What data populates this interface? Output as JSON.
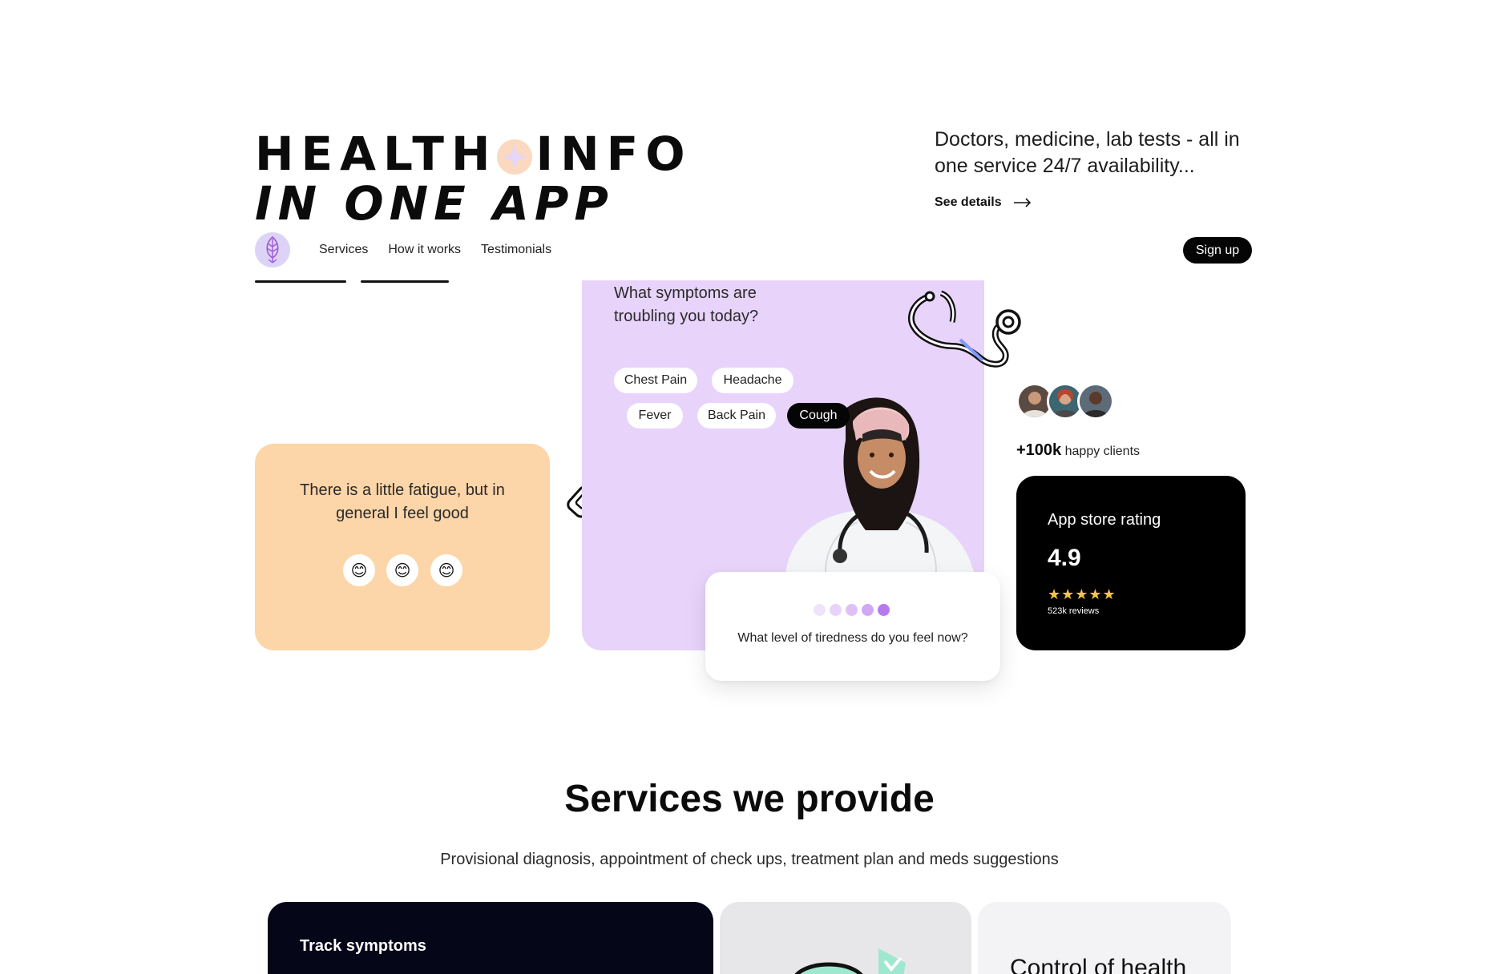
{
  "hero": {
    "line1_a": "HEALTH",
    "line1_b": "INFO",
    "line2": "IN ONE APP"
  },
  "tagline": {
    "text": "Doctors, medicine, lab tests - all in one service 24/7 availability...",
    "cta": "See details"
  },
  "nav": {
    "items": [
      "Services",
      "How it works",
      "Testimonials"
    ],
    "signup": "Sign up"
  },
  "mood_card": {
    "text": "There is a little fatigue, but in general I feel good",
    "emojis": [
      "😊",
      "😊",
      "😊"
    ]
  },
  "symptoms_card": {
    "question": "What symptoms are troubling you today?",
    "chips": [
      "Chest Pain",
      "Headache",
      "Fever",
      "Back Pain",
      "Cough"
    ],
    "selected": "Cough"
  },
  "tiredness_card": {
    "question": "What level of tiredness do you feel now?",
    "level": 5,
    "max_level": 5
  },
  "social_proof": {
    "count": "+100k",
    "label": "happy clients"
  },
  "rating_card": {
    "title": "App store rating",
    "value": "4.9",
    "stars": "★★★★★",
    "reviews": "523k reviews"
  },
  "services": {
    "title": "Services we provide",
    "subtitle": "Provisional diagnosis, appointment of check ups, treatment plan and meds suggestions",
    "cards": [
      "Track symptoms",
      "",
      "Control of health"
    ]
  },
  "colors": {
    "peach": "#fcd5a8",
    "lavender": "#e8d3fb",
    "dark": "#050505",
    "star": "#f5c448",
    "accent_purple": "#b679ee"
  }
}
